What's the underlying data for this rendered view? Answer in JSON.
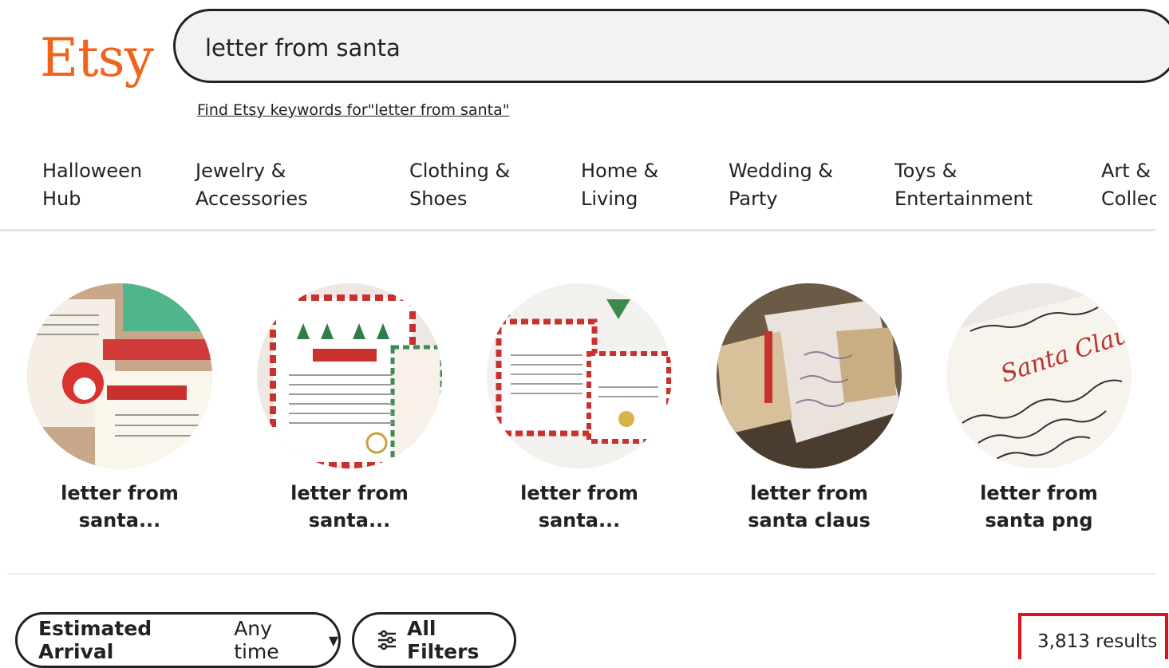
{
  "logo": {
    "text": "Etsy",
    "color": "#f1641e"
  },
  "search": {
    "query": "letter from santa"
  },
  "keywords_link": "Find Etsy keywords for\"letter from santa\"",
  "nav": {
    "items": [
      {
        "line1": "Halloween",
        "line2": "Hub"
      },
      {
        "line1": "Jewelry &",
        "line2": "Accessories"
      },
      {
        "line1": "Clothing &",
        "line2": "Shoes"
      },
      {
        "line1": "Home &",
        "line2": "Living"
      },
      {
        "line1": "Wedding &",
        "line2": "Party"
      },
      {
        "line1": "Toys &",
        "line2": "Entertainment"
      },
      {
        "line1": "Art &",
        "line2": "Collectibles"
      }
    ]
  },
  "suggestions": [
    {
      "line1": "letter from",
      "line2": "santa..."
    },
    {
      "line1": "letter from",
      "line2": "santa..."
    },
    {
      "line1": "letter from",
      "line2": "santa..."
    },
    {
      "line1": "letter from",
      "line2": "santa claus"
    },
    {
      "line1": "letter from",
      "line2": "santa png"
    }
  ],
  "filters": {
    "arrival_label": "Estimated Arrival",
    "arrival_value": "Any time",
    "all_filters": "All Filters"
  },
  "results_count": "3,813 results",
  "colors": {
    "accent": "#f1641e",
    "highlight": "#e0111c"
  },
  "icons": {
    "dropdown": "caret-down-icon",
    "filters": "sliders-icon"
  }
}
